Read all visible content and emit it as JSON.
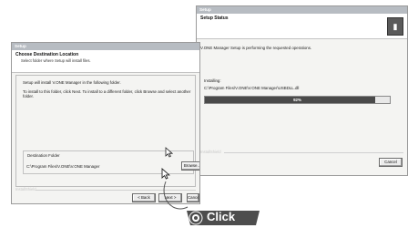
{
  "status_window": {
    "title": "Setup",
    "header_title": "Setup Status",
    "message": "V.ONE Manager Setup is performing the requested operations.",
    "installing_label": "Installing:",
    "installing_path": "C:\\Program Files\\V.ONE\\V.ONE Manager\\USBDLL.dll",
    "progress_percent": 92,
    "progress_text": "92%",
    "footer_brand": "InstallShield",
    "cancel_label": "Cancel"
  },
  "dest_window": {
    "title": "Setup",
    "header_title": "Choose Destination Location",
    "header_subtitle": "Select folder where Setup will install files.",
    "line1": "Setup will install V.ONE Manager in the following folder.",
    "line2": "To install to this folder, click Next. To install to a different folder, click Browse and select another folder.",
    "folder_legend": "Destination Folder",
    "folder_path": "C:\\Program Files\\V.ONE\\V.ONE Manager",
    "browse_label": "Browse...",
    "footer_brand": "InstallShield",
    "back_label": "< Back",
    "next_label": "Next >",
    "cancel_label": "Cancel"
  },
  "badge": {
    "label": "Click"
  },
  "colors": {
    "progress_fill": "#4a4a4a",
    "titlebar": "#b7bcc2",
    "badge": "#4d4d4d"
  }
}
